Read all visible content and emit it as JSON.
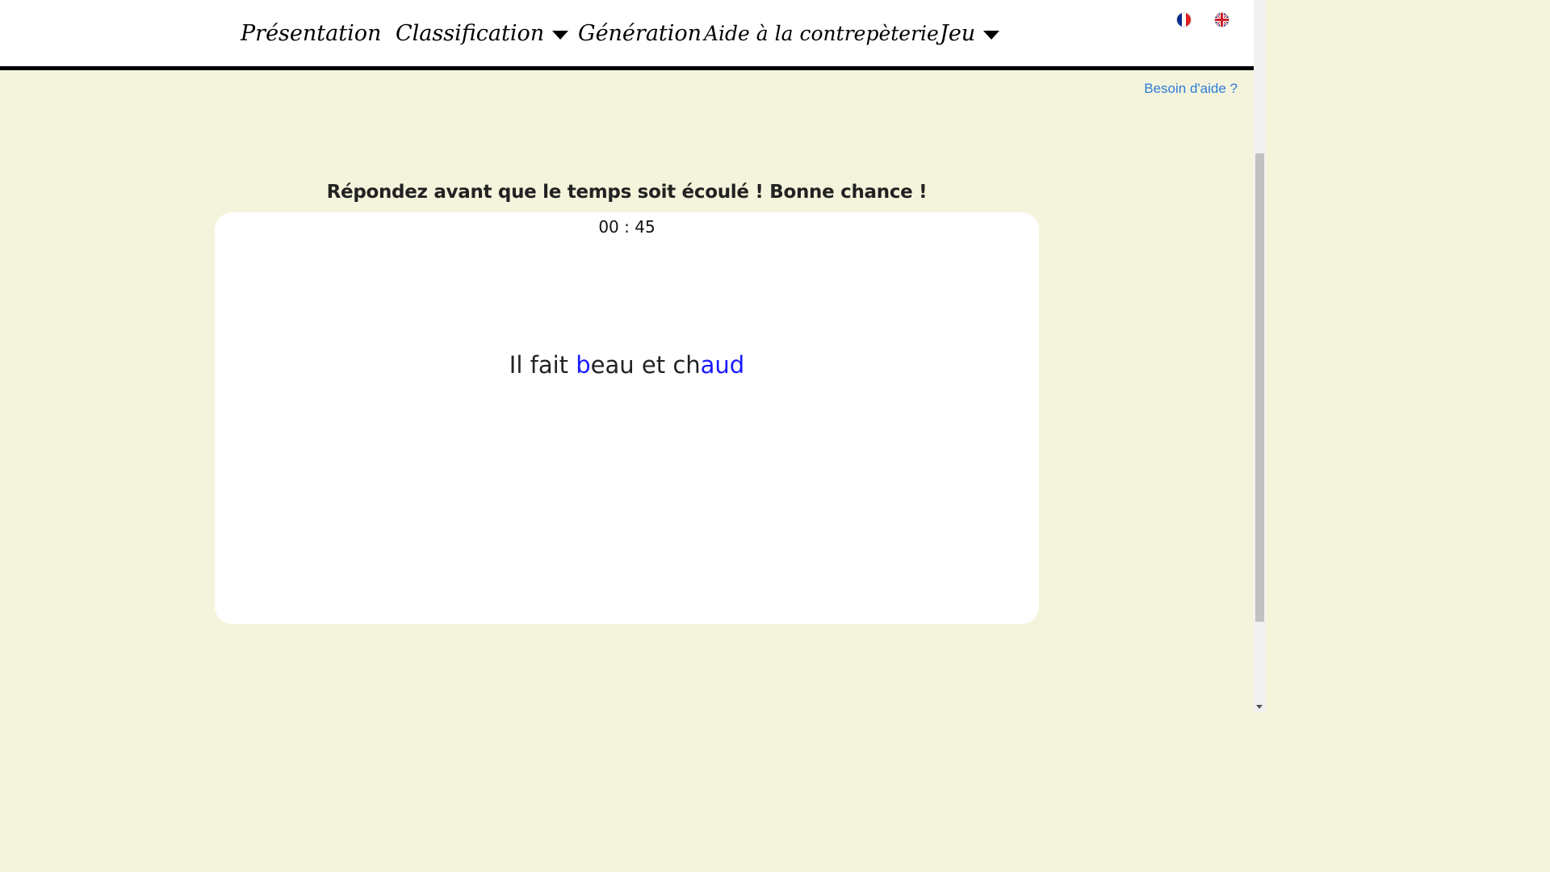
{
  "nav": {
    "items": [
      {
        "label": "Présentation",
        "has_dropdown": false
      },
      {
        "label": "Classification",
        "has_dropdown": true
      },
      {
        "label": "Génération",
        "has_dropdown": false
      },
      {
        "label": "Aide à la contrepèterie",
        "has_dropdown": false
      },
      {
        "label": "Jeu",
        "has_dropdown": true
      }
    ],
    "languages": [
      {
        "icon": "french-flag-icon"
      },
      {
        "icon": "uk-flag-icon"
      }
    ]
  },
  "help_link": "Besoin d'aide ?",
  "game": {
    "instruction": "Répondez avant que le temps soit écoulé ! Bonne chance !",
    "timer": "00 : 45",
    "phrase_segments": [
      {
        "text": "Il fait ",
        "highlight": false
      },
      {
        "text": "b",
        "highlight": true
      },
      {
        "text": "eau et ch",
        "highlight": false
      },
      {
        "text": "aud",
        "highlight": true
      }
    ]
  },
  "colors": {
    "background": "#f4f4dc",
    "highlight": "#1a1aff",
    "link": "#2b7bd9"
  }
}
